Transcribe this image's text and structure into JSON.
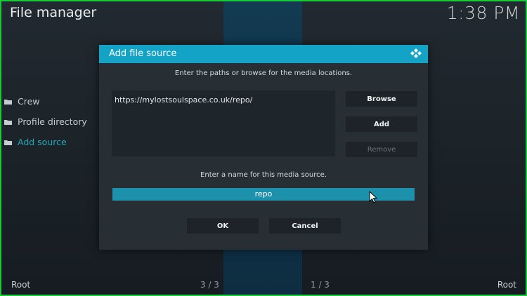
{
  "window": {
    "title": "File manager",
    "clock": "1:38 PM"
  },
  "sidebar": {
    "items": [
      {
        "label": "Crew",
        "active": false
      },
      {
        "label": "Profile directory",
        "active": false
      },
      {
        "label": "Add source",
        "active": true
      }
    ]
  },
  "footer": {
    "left": "Root",
    "page_left": "3 / 3",
    "page_right": "1 / 3",
    "right": "Root"
  },
  "dialog": {
    "title": "Add file source",
    "instruction_paths": "Enter the paths or browse for the media locations.",
    "path_value": "https://mylostsoulspace.co.uk/repo/",
    "buttons": {
      "browse": "Browse",
      "add": "Add",
      "remove": "Remove"
    },
    "instruction_name": "Enter a name for this media source.",
    "name_value": "repo",
    "ok": "OK",
    "cancel": "Cancel"
  },
  "colors": {
    "accent": "#12a3c7",
    "active_item": "#21a9b5",
    "frame": "#18c93a"
  },
  "icons": {
    "folder": "folder-icon",
    "kodi": "kodi-logo-icon",
    "cursor": "mouse-pointer-icon"
  }
}
